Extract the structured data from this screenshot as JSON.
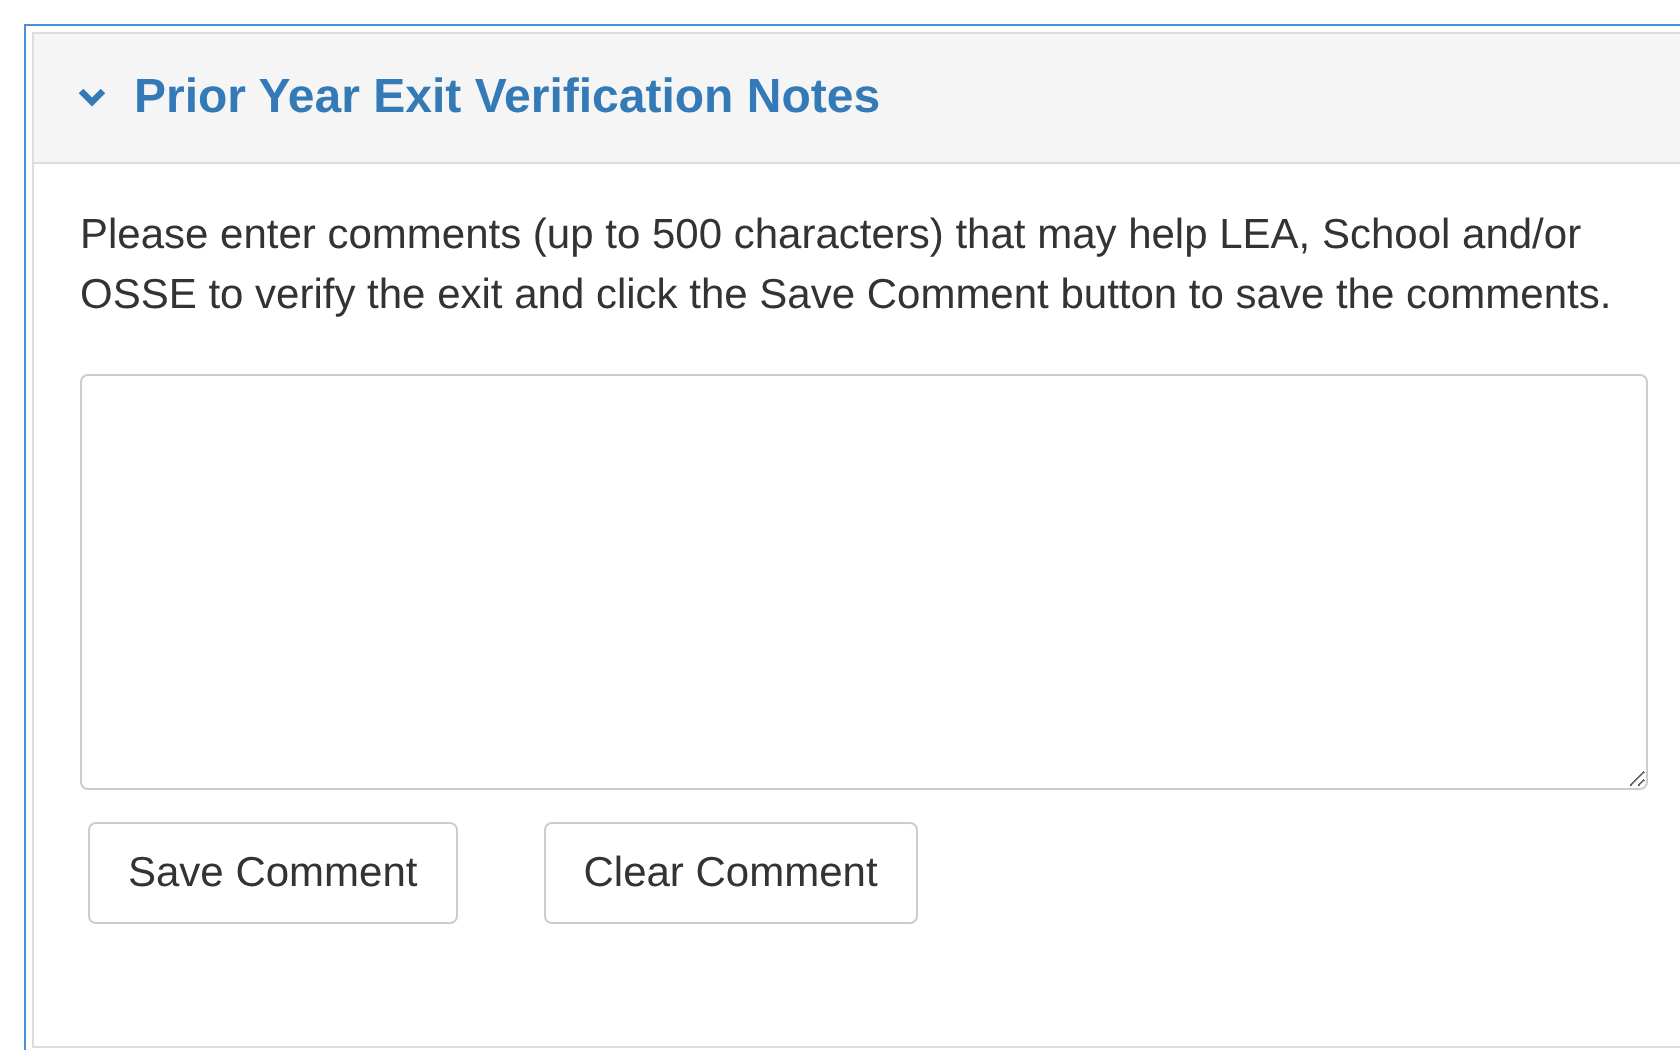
{
  "panel": {
    "title": "Prior Year Exit Verification Notes",
    "expanded": true
  },
  "instructions": "Please enter comments (up to 500 characters) that may help LEA, School and/or OSSE to verify the exit and click the Save Comment button to save the comments.",
  "buttons": [
    "Save Comment",
    "Clear Comment"
  ]
}
